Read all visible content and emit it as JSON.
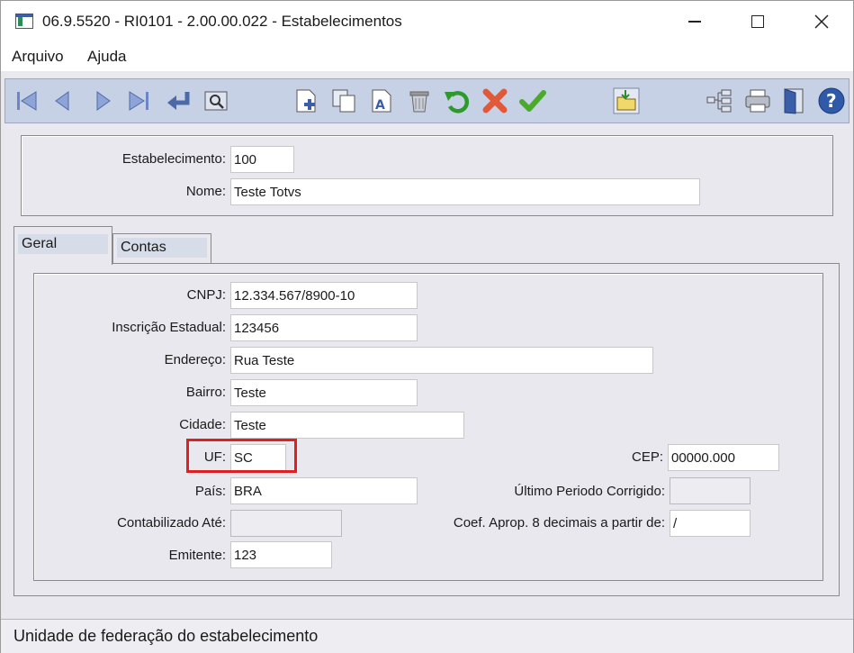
{
  "window": {
    "title": "06.9.5520 - RI0101 - 2.00.00.022 - Estabelecimentos"
  },
  "menu": {
    "items": [
      "Arquivo",
      "Ajuda"
    ]
  },
  "toolbar": {
    "buttons": [
      "first-icon",
      "previous-icon",
      "next-icon",
      "last-icon",
      "goto-icon",
      "search-icon",
      "new-icon",
      "copy-icon",
      "edit-icon",
      "delete-icon",
      "undo-icon",
      "cancel-icon",
      "save-icon",
      "folder-icon",
      "tree-icon",
      "print-icon",
      "exit-icon",
      "help-icon"
    ]
  },
  "header": {
    "estabelecimento_label": "Estabelecimento:",
    "estabelecimento_value": "100",
    "nome_label": "Nome:",
    "nome_value": "Teste Totvs"
  },
  "tabs": [
    {
      "label": "Geral",
      "active": true
    },
    {
      "label": "Contas",
      "active": false
    }
  ],
  "form": {
    "cnpj_label": "CNPJ:",
    "cnpj_value": "12.334.567/8900-10",
    "ie_label": "Inscrição Estadual:",
    "ie_value": "123456",
    "endereco_label": "Endereço:",
    "endereco_value": "Rua Teste",
    "bairro_label": "Bairro:",
    "bairro_value": "Teste",
    "cidade_label": "Cidade:",
    "cidade_value": "Teste",
    "uf_label": "UF:",
    "uf_value": "SC",
    "cep_label": "CEP:",
    "cep_value": "00000.000",
    "pais_label": "País:",
    "pais_value": "BRA",
    "ultimo_label": "Último Periodo Corrigido:",
    "ultimo_value": "",
    "contab_label": "Contabilizado Até:",
    "contab_value": "",
    "coef_label": "Coef. Aprop. 8 decimais a partir de:",
    "coef_value": " /",
    "emitente_label": "Emitente:",
    "emitente_value": "123"
  },
  "status": {
    "text": "Unidade de federação do estabelecimento"
  },
  "colors": {
    "highlight": "#e02020",
    "toolbar_bg": "#c7d1e6",
    "accent_blue": "#2f5aa8"
  }
}
